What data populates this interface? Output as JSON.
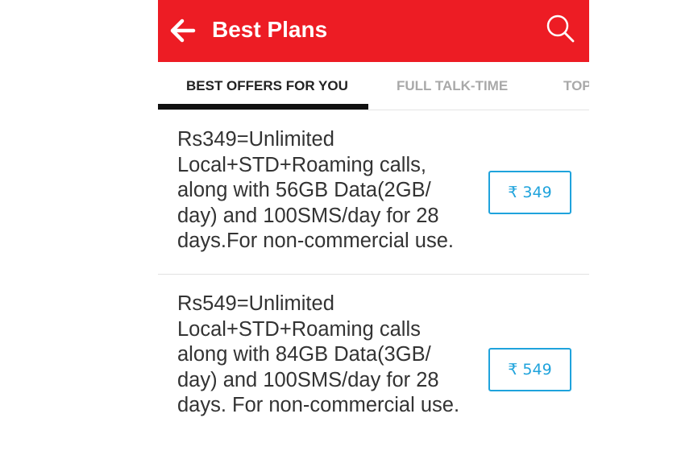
{
  "appbar": {
    "title": "Best Plans",
    "back_icon": "arrow-left-icon",
    "search_icon": "search-icon",
    "color": "#ed1c24"
  },
  "tabs": [
    {
      "label": "BEST OFFERS FOR YOU",
      "active": true
    },
    {
      "label": "FULL TALK-TIME",
      "active": false
    },
    {
      "label": "TOP",
      "active": false
    }
  ],
  "plans": [
    {
      "description": "Rs349=Unlimited Local+STD+Roaming calls, along with 56GB Data(2GB/ day) and 100SMS/day for 28 days.For non-commercial use.",
      "price_label": "₹ 349"
    },
    {
      "description": "Rs549=Unlimited Local+STD+Roaming calls along with 84GB Data(3GB/ day) and 100SMS/day for 28 days. For non-commercial use.",
      "price_label": "₹ 549"
    }
  ],
  "colors": {
    "accent": "#1fa3dc",
    "text": "#333333",
    "inactive_tab": "#a9a9a9"
  }
}
